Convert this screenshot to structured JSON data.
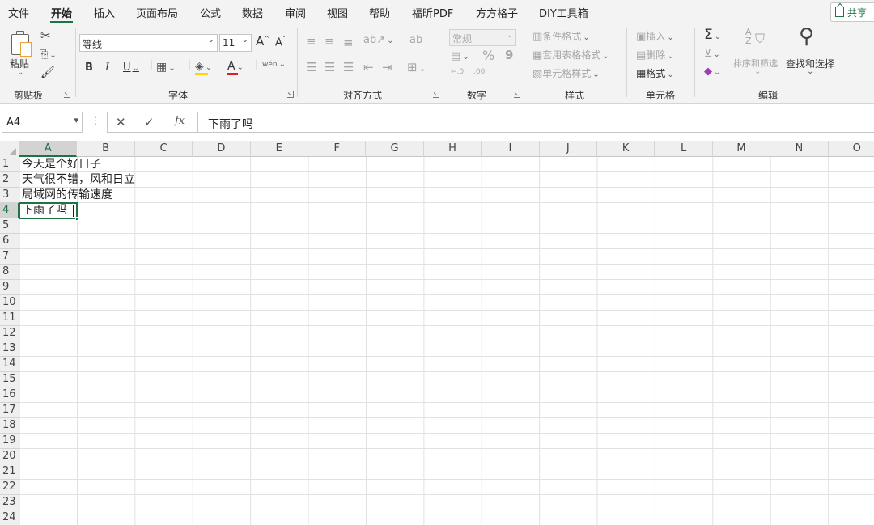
{
  "menu": {
    "items": [
      "文件",
      "开始",
      "插入",
      "页面布局",
      "公式",
      "数据",
      "审阅",
      "视图",
      "帮助",
      "福昕PDF",
      "方方格子",
      "DIY工具箱"
    ],
    "share": "共享"
  },
  "ribbon": {
    "clipboard": {
      "paste": "粘贴",
      "label": "剪贴板"
    },
    "font": {
      "name": "等线",
      "size": "11",
      "bold": "B",
      "italic": "I",
      "underline": "U",
      "grow": "A",
      "shrink": "A",
      "font_color": "A",
      "phonetic": "wén",
      "label": "字体"
    },
    "alignment": {
      "label": "对齐方式"
    },
    "number": {
      "format": "常规",
      "percent": "%",
      "comma": "9",
      "inc_decimal": "←.0",
      "dec_decimal": ".00",
      "label": "数字"
    },
    "styles": {
      "conditional": "条件格式",
      "table": "套用表格格式",
      "cell_styles": "单元格样式",
      "label": "样式"
    },
    "cells": {
      "insert": "插入",
      "delete": "删除",
      "format": "格式",
      "label": "单元格"
    },
    "editing": {
      "sum": "Σ",
      "sort_filter": "排序和筛选",
      "find_select": "查找和选择",
      "label": "编辑"
    }
  },
  "formula_bar": {
    "name_box": "A4",
    "cancel": "✕",
    "enter": "✓",
    "fx": "fx",
    "content": "下雨了吗"
  },
  "sheet": {
    "columns": [
      "A",
      "B",
      "C",
      "D",
      "E",
      "F",
      "G",
      "H",
      "I",
      "J",
      "K",
      "L",
      "M",
      "N",
      "O"
    ],
    "rows": [
      "1",
      "2",
      "3",
      "4",
      "5",
      "6",
      "7",
      "8",
      "9",
      "10",
      "11",
      "12",
      "13",
      "14",
      "15",
      "16",
      "17",
      "18",
      "19",
      "20",
      "21",
      "22",
      "23",
      "24"
    ],
    "cells": {
      "A1": "今天是个好日子",
      "A2": "天气很不错，风和日立",
      "A3": "局域网的传输速度",
      "A4": "下雨了吗"
    },
    "active_cell": "A4",
    "selection_color": "#217346"
  }
}
